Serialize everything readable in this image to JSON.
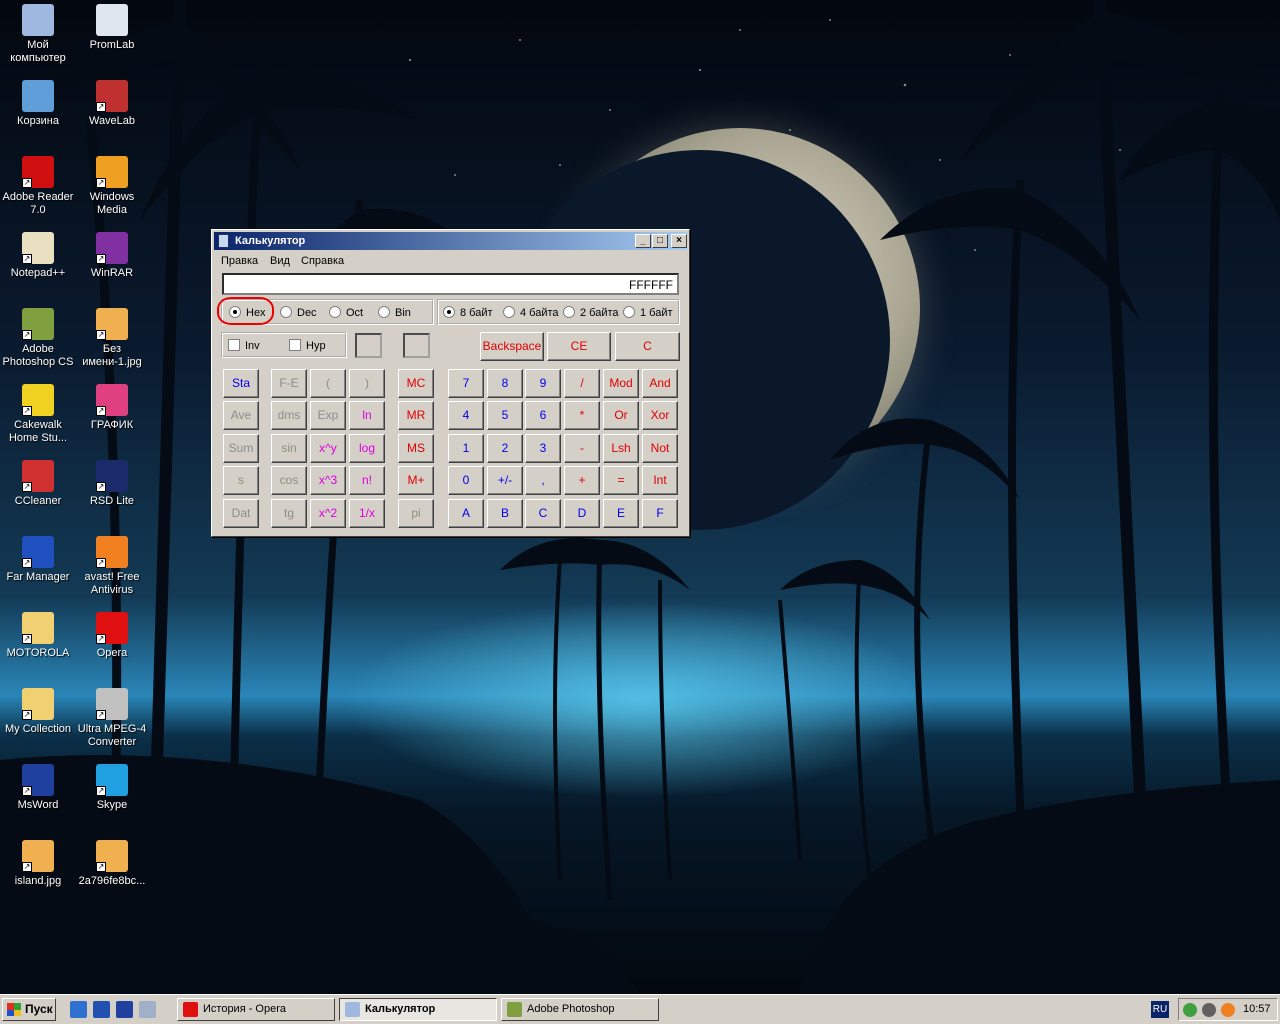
{
  "desktop_icons": [
    {
      "label": "Мой компьютер",
      "icon": "my-computer-icon",
      "color": "#9fb8e0"
    },
    {
      "label": "PromLab",
      "icon": "promlab-icon",
      "color": "#dfe6ef"
    },
    {
      "label": "Корзина",
      "icon": "recycle-bin-icon",
      "color": "#5f9ed8"
    },
    {
      "label": "WaveLab",
      "icon": "wavelab-icon",
      "color": "#c03030"
    },
    {
      "label": "Adobe Reader 7.0",
      "icon": "adobe-reader-icon",
      "color": "#d01010"
    },
    {
      "label": "Windows Media",
      "icon": "windows-media-icon",
      "color": "#f0a020"
    },
    {
      "label": "Notepad++",
      "icon": "notepad-icon",
      "color": "#e8e0c0"
    },
    {
      "label": "WinRAR",
      "icon": "winrar-icon",
      "color": "#8030a0"
    },
    {
      "label": "Adobe Photoshop CS",
      "icon": "photoshop-icon",
      "color": "#80a040"
    },
    {
      "label": "Без имени-1.jpg",
      "icon": "jpg-file-icon",
      "color": "#f0b050"
    },
    {
      "label": "Cakewalk Home Stu...",
      "icon": "cakewalk-icon",
      "color": "#f0d020"
    },
    {
      "label": "ГРАФИК",
      "icon": "msworks-icon",
      "color": "#e04080"
    },
    {
      "label": "CCleaner",
      "icon": "ccleaner-icon",
      "color": "#d03030"
    },
    {
      "label": "RSD Lite",
      "icon": "motorola-icon",
      "color": "#1a2a6a"
    },
    {
      "label": "Far Manager",
      "icon": "far-manager-icon",
      "color": "#2050c0"
    },
    {
      "label": "avast! Free Antivirus",
      "icon": "avast-icon",
      "color": "#f08020"
    },
    {
      "label": "MOTOROLA",
      "icon": "folder-icon",
      "color": "#f0d070"
    },
    {
      "label": "Opera",
      "icon": "opera-icon",
      "color": "#e01010"
    },
    {
      "label": "My Collection",
      "icon": "folder-icon",
      "color": "#f0d070"
    },
    {
      "label": "Ultra MPEG-4 Converter",
      "icon": "mpeg-converter-icon",
      "color": "#c0c0c0"
    },
    {
      "label": "MsWord",
      "icon": "word-icon",
      "color": "#2040a0"
    },
    {
      "label": "Skype",
      "icon": "skype-icon",
      "color": "#20a0e0"
    },
    {
      "label": "island.jpg",
      "icon": "jpg-file-icon",
      "color": "#f0b050"
    },
    {
      "label": "2a796fe8bc...",
      "icon": "jpg-file-icon",
      "color": "#f0b050"
    }
  ],
  "calculator": {
    "title": "Калькулятор",
    "menu": [
      "Правка",
      "Вид",
      "Справка"
    ],
    "display": "FFFFFF",
    "radix": [
      {
        "label": "Hex",
        "checked": true
      },
      {
        "label": "Dec",
        "checked": false
      },
      {
        "label": "Oct",
        "checked": false
      },
      {
        "label": "Bin",
        "checked": false
      }
    ],
    "word_size": [
      {
        "label": "8 байт",
        "checked": true
      },
      {
        "label": "4 байта",
        "checked": false
      },
      {
        "label": "2 байта",
        "checked": false
      },
      {
        "label": "1 байт",
        "checked": false
      }
    ],
    "checks": [
      {
        "label": "Inv",
        "checked": false
      },
      {
        "label": "Hyp",
        "checked": false
      }
    ],
    "top_buttons": [
      "Backspace",
      "CE",
      "C"
    ],
    "grid": [
      [
        [
          "Sta",
          "blue"
        ],
        [
          "F-E",
          "gray"
        ],
        [
          "(",
          "gray"
        ],
        [
          ")",
          "gray"
        ],
        [
          "MC",
          "red"
        ],
        [
          "7",
          "blue"
        ],
        [
          "8",
          "blue"
        ],
        [
          "9",
          "blue"
        ],
        [
          "/",
          "red"
        ],
        [
          "Mod",
          "red"
        ],
        [
          "And",
          "red"
        ]
      ],
      [
        [
          "Ave",
          "gray"
        ],
        [
          "dms",
          "gray"
        ],
        [
          "Exp",
          "gray"
        ],
        [
          "ln",
          "pink"
        ],
        [
          "MR",
          "red"
        ],
        [
          "4",
          "blue"
        ],
        [
          "5",
          "blue"
        ],
        [
          "6",
          "blue"
        ],
        [
          "*",
          "red"
        ],
        [
          "Or",
          "red"
        ],
        [
          "Xor",
          "red"
        ]
      ],
      [
        [
          "Sum",
          "gray"
        ],
        [
          "sin",
          "gray"
        ],
        [
          "x^y",
          "pink"
        ],
        [
          "log",
          "pink"
        ],
        [
          "MS",
          "red"
        ],
        [
          "1",
          "blue"
        ],
        [
          "2",
          "blue"
        ],
        [
          "3",
          "blue"
        ],
        [
          "-",
          "red"
        ],
        [
          "Lsh",
          "red"
        ],
        [
          "Not",
          "red"
        ]
      ],
      [
        [
          "s",
          "gray"
        ],
        [
          "cos",
          "gray"
        ],
        [
          "x^3",
          "pink"
        ],
        [
          "n!",
          "pink"
        ],
        [
          "M+",
          "red"
        ],
        [
          "0",
          "blue"
        ],
        [
          "+/-",
          "blue"
        ],
        [
          ",",
          "blue"
        ],
        [
          "+",
          "red"
        ],
        [
          "=",
          "red"
        ],
        [
          "Int",
          "red"
        ]
      ],
      [
        [
          "Dat",
          "gray"
        ],
        [
          "tg",
          "gray"
        ],
        [
          "x^2",
          "pink"
        ],
        [
          "1/x",
          "pink"
        ],
        [
          "pi",
          "gray"
        ],
        [
          "A",
          "blue"
        ],
        [
          "B",
          "blue"
        ],
        [
          "C",
          "blue"
        ],
        [
          "D",
          "blue"
        ],
        [
          "E",
          "blue"
        ],
        [
          "F",
          "blue"
        ]
      ]
    ]
  },
  "taskbar": {
    "start_label": "Пуск",
    "quick_launch": [
      {
        "icon": "ie-icon",
        "color": "#3070d0"
      },
      {
        "icon": "show-desktop-icon",
        "color": "#2050b0"
      },
      {
        "icon": "word-icon",
        "color": "#2040a0"
      },
      {
        "icon": "calculator-icon",
        "color": "#a0b0c8"
      }
    ],
    "tasks": [
      {
        "label": "История - Opera",
        "icon": "opera-icon",
        "color": "#e01010",
        "active": false
      },
      {
        "label": "Калькулятор",
        "icon": "calculator-icon",
        "color": "#a0b8e0",
        "active": true
      },
      {
        "label": "Adobe Photoshop",
        "icon": "photoshop-icon",
        "color": "#80a040",
        "active": false
      }
    ],
    "language": "RU",
    "tray_icons": [
      {
        "icon": "network-icon",
        "color": "#40a040"
      },
      {
        "icon": "volume-icon",
        "color": "#606060"
      },
      {
        "icon": "avast-tray-icon",
        "color": "#f08020"
      }
    ],
    "clock": "10:57"
  }
}
